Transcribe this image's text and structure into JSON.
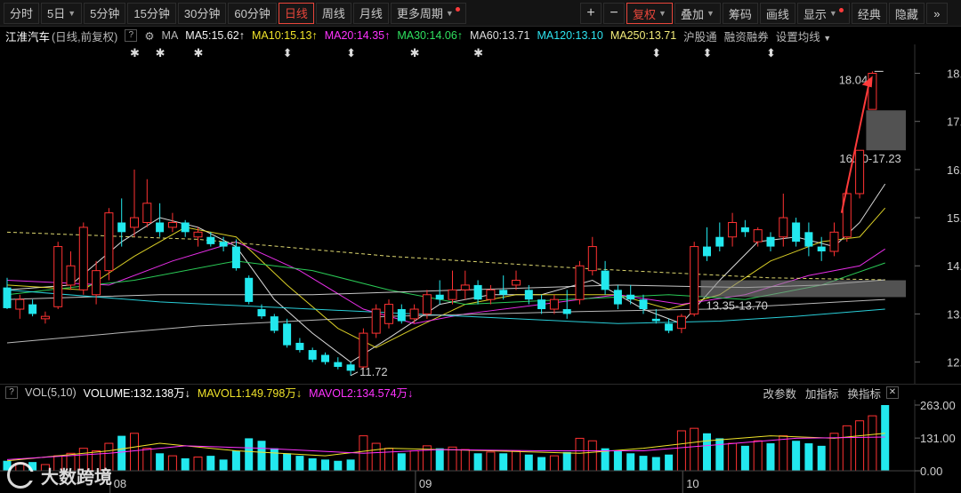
{
  "toolbar": {
    "periods": [
      {
        "label": "分时",
        "active": false,
        "caret": false
      },
      {
        "label": "5日",
        "active": false,
        "caret": true
      },
      {
        "label": "5分钟",
        "active": false,
        "caret": false
      },
      {
        "label": "15分钟",
        "active": false,
        "caret": false
      },
      {
        "label": "30分钟",
        "active": false,
        "caret": false
      },
      {
        "label": "60分钟",
        "active": false,
        "caret": false
      },
      {
        "label": "日线",
        "active": true,
        "caret": false
      },
      {
        "label": "周线",
        "active": false,
        "caret": false
      },
      {
        "label": "月线",
        "active": false,
        "caret": false
      },
      {
        "label": "更多周期",
        "active": false,
        "caret": true,
        "dot": true
      }
    ],
    "zoom_in": "+",
    "zoom_out": "−",
    "fuquan": "复权",
    "right_buttons": [
      {
        "label": "叠加",
        "caret": true
      },
      {
        "label": "筹码",
        "caret": false
      },
      {
        "label": "画线",
        "caret": false
      },
      {
        "label": "显示",
        "caret": true,
        "dot": true
      },
      {
        "label": "经典",
        "caret": false
      },
      {
        "label": "隐藏",
        "caret": false
      }
    ],
    "more_arrow": "»"
  },
  "ma_line": {
    "stock_name": "江淮汽车",
    "mode": "(日线,前复权)",
    "help": "?",
    "ma_label": "MA",
    "ma5": "MA5:15.62",
    "ma10": "MA10:15.13",
    "ma20": "MA20:14.35",
    "ma30": "MA30:14.06",
    "ma60": "MA60:13.71",
    "ma120": "MA120:13.10",
    "ma250": "MA250:13.71",
    "hgt": "沪股通",
    "rzrq": "融资融券",
    "set_ma": "设置均线",
    "up_arrow": "↑",
    "colors": {
      "ma5": "#f2f2f2",
      "ma10": "#f0e32a",
      "ma20": "#ff33ff",
      "ma30": "#2fe05f",
      "ma60": "#dddddd",
      "ma120": "#2ee4f0",
      "ma250": "#f3ec7a"
    }
  },
  "chart_data": {
    "type": "candlestick",
    "price_ticks": [
      "18.00",
      "17.00",
      "16.00",
      "15.00",
      "14.00",
      "13.00",
      "12.00"
    ],
    "ylim": [
      11.55,
      18.6
    ],
    "month_labels": [
      {
        "label": "08",
        "index": 9
      },
      {
        "label": "09",
        "index": 33
      },
      {
        "label": "10",
        "index": 54
      }
    ],
    "candles": [
      {
        "o": 13.55,
        "h": 13.75,
        "l": 13.1,
        "c": 13.12
      },
      {
        "o": 13.1,
        "h": 13.4,
        "l": 12.9,
        "c": 13.3
      },
      {
        "o": 13.2,
        "h": 13.3,
        "l": 12.95,
        "c": 13.0
      },
      {
        "o": 12.9,
        "h": 13.05,
        "l": 12.8,
        "c": 12.95
      },
      {
        "o": 13.15,
        "h": 14.5,
        "l": 13.1,
        "c": 14.4
      },
      {
        "o": 13.6,
        "h": 14.3,
        "l": 13.5,
        "c": 14.0
      },
      {
        "o": 13.5,
        "h": 14.9,
        "l": 13.4,
        "c": 14.8
      },
      {
        "o": 13.4,
        "h": 14.1,
        "l": 13.2,
        "c": 13.9
      },
      {
        "o": 13.9,
        "h": 15.2,
        "l": 13.7,
        "c": 15.1
      },
      {
        "o": 14.9,
        "h": 15.4,
        "l": 14.4,
        "c": 14.7
      },
      {
        "o": 14.8,
        "h": 16.0,
        "l": 14.6,
        "c": 15.0
      },
      {
        "o": 14.9,
        "h": 15.8,
        "l": 14.8,
        "c": 15.3
      },
      {
        "o": 14.9,
        "h": 15.3,
        "l": 14.6,
        "c": 14.7
      },
      {
        "o": 14.8,
        "h": 15.1,
        "l": 14.7,
        "c": 14.9
      },
      {
        "o": 14.9,
        "h": 14.95,
        "l": 14.6,
        "c": 14.7
      },
      {
        "o": 14.6,
        "h": 14.8,
        "l": 14.4,
        "c": 14.7
      },
      {
        "o": 14.6,
        "h": 14.7,
        "l": 14.4,
        "c": 14.45
      },
      {
        "o": 14.5,
        "h": 14.6,
        "l": 14.3,
        "c": 14.4
      },
      {
        "o": 14.4,
        "h": 14.55,
        "l": 13.9,
        "c": 13.95
      },
      {
        "o": 13.75,
        "h": 13.8,
        "l": 13.2,
        "c": 13.25
      },
      {
        "o": 13.1,
        "h": 13.2,
        "l": 12.9,
        "c": 12.95
      },
      {
        "o": 12.95,
        "h": 13.0,
        "l": 12.6,
        "c": 12.65
      },
      {
        "o": 12.8,
        "h": 12.9,
        "l": 12.3,
        "c": 12.35
      },
      {
        "o": 12.4,
        "h": 12.5,
        "l": 12.2,
        "c": 12.25
      },
      {
        "o": 12.25,
        "h": 12.3,
        "l": 12.0,
        "c": 12.05
      },
      {
        "o": 12.15,
        "h": 12.2,
        "l": 11.95,
        "c": 12.0
      },
      {
        "o": 12.0,
        "h": 12.1,
        "l": 11.85,
        "c": 11.9
      },
      {
        "o": 11.95,
        "h": 12.0,
        "l": 11.72,
        "c": 11.82
      },
      {
        "o": 11.9,
        "h": 12.7,
        "l": 11.85,
        "c": 12.6
      },
      {
        "o": 12.6,
        "h": 13.2,
        "l": 12.5,
        "c": 13.1
      },
      {
        "o": 12.8,
        "h": 13.3,
        "l": 12.7,
        "c": 13.2
      },
      {
        "o": 13.1,
        "h": 13.2,
        "l": 12.8,
        "c": 12.85
      },
      {
        "o": 12.9,
        "h": 13.2,
        "l": 12.8,
        "c": 13.1
      },
      {
        "o": 13.0,
        "h": 13.5,
        "l": 12.9,
        "c": 13.4
      },
      {
        "o": 13.4,
        "h": 13.7,
        "l": 13.2,
        "c": 13.3
      },
      {
        "o": 13.3,
        "h": 13.9,
        "l": 13.2,
        "c": 13.5
      },
      {
        "o": 13.5,
        "h": 13.9,
        "l": 13.3,
        "c": 13.6
      },
      {
        "o": 13.6,
        "h": 13.7,
        "l": 13.2,
        "c": 13.3
      },
      {
        "o": 13.3,
        "h": 13.6,
        "l": 13.2,
        "c": 13.5
      },
      {
        "o": 13.5,
        "h": 13.8,
        "l": 13.3,
        "c": 13.4
      },
      {
        "o": 13.6,
        "h": 13.9,
        "l": 13.5,
        "c": 13.7
      },
      {
        "o": 13.5,
        "h": 13.6,
        "l": 13.2,
        "c": 13.3
      },
      {
        "o": 13.3,
        "h": 13.4,
        "l": 13.0,
        "c": 13.1
      },
      {
        "o": 13.1,
        "h": 13.4,
        "l": 13.0,
        "c": 13.3
      },
      {
        "o": 13.1,
        "h": 13.5,
        "l": 12.9,
        "c": 13.0
      },
      {
        "o": 13.3,
        "h": 14.1,
        "l": 13.2,
        "c": 14.0
      },
      {
        "o": 13.9,
        "h": 14.6,
        "l": 13.8,
        "c": 14.4
      },
      {
        "o": 13.9,
        "h": 14.1,
        "l": 13.4,
        "c": 13.5
      },
      {
        "o": 13.5,
        "h": 13.6,
        "l": 13.1,
        "c": 13.2
      },
      {
        "o": 13.4,
        "h": 13.6,
        "l": 13.2,
        "c": 13.3
      },
      {
        "o": 13.3,
        "h": 13.4,
        "l": 13.0,
        "c": 13.1
      },
      {
        "o": 12.9,
        "h": 13.1,
        "l": 12.8,
        "c": 12.85
      },
      {
        "o": 12.8,
        "h": 12.9,
        "l": 12.6,
        "c": 12.65
      },
      {
        "o": 12.7,
        "h": 13.0,
        "l": 12.6,
        "c": 12.95
      },
      {
        "o": 13.0,
        "h": 14.5,
        "l": 12.95,
        "c": 14.4
      },
      {
        "o": 14.4,
        "h": 14.8,
        "l": 14.1,
        "c": 14.2
      },
      {
        "o": 14.6,
        "h": 14.9,
        "l": 14.3,
        "c": 14.4
      },
      {
        "o": 14.6,
        "h": 15.1,
        "l": 14.4,
        "c": 14.9
      },
      {
        "o": 14.8,
        "h": 14.95,
        "l": 14.6,
        "c": 14.7
      },
      {
        "o": 14.5,
        "h": 14.8,
        "l": 14.4,
        "c": 14.75
      },
      {
        "o": 14.6,
        "h": 14.7,
        "l": 14.3,
        "c": 14.4
      },
      {
        "o": 14.6,
        "h": 15.5,
        "l": 14.4,
        "c": 15.0
      },
      {
        "o": 14.9,
        "h": 15.0,
        "l": 14.4,
        "c": 14.5
      },
      {
        "o": 14.7,
        "h": 14.9,
        "l": 14.2,
        "c": 14.4
      },
      {
        "o": 14.4,
        "h": 14.6,
        "l": 14.1,
        "c": 14.3
      },
      {
        "o": 14.3,
        "h": 14.9,
        "l": 14.2,
        "c": 14.7
      },
      {
        "o": 14.6,
        "h": 15.6,
        "l": 14.5,
        "c": 15.5
      },
      {
        "o": 15.5,
        "h": 16.4,
        "l": 15.4,
        "c": 16.4
      },
      {
        "o": 17.25,
        "h": 18.04,
        "l": 17.25,
        "c": 18.0
      }
    ],
    "ma_series": [
      {
        "key": "ma5",
        "color": "#f2f2f2",
        "values": [
          [
            0,
            13.5
          ],
          [
            5,
            13.6
          ],
          [
            9,
            14.5
          ],
          [
            12,
            15.0
          ],
          [
            15,
            14.8
          ],
          [
            18,
            14.4
          ],
          [
            21,
            13.3
          ],
          [
            24,
            12.6
          ],
          [
            27,
            12.0
          ],
          [
            30,
            12.5
          ],
          [
            34,
            13.2
          ],
          [
            38,
            13.4
          ],
          [
            42,
            13.4
          ],
          [
            46,
            13.7
          ],
          [
            50,
            13.1
          ],
          [
            53,
            12.8
          ],
          [
            56,
            13.7
          ],
          [
            59,
            14.5
          ],
          [
            62,
            14.6
          ],
          [
            65,
            14.4
          ],
          [
            67,
            14.9
          ],
          [
            69,
            15.7
          ]
        ]
      },
      {
        "key": "ma10",
        "color": "#f0e32a",
        "values": [
          [
            0,
            13.6
          ],
          [
            6,
            13.5
          ],
          [
            10,
            14.2
          ],
          [
            14,
            14.8
          ],
          [
            18,
            14.6
          ],
          [
            22,
            13.6
          ],
          [
            26,
            12.7
          ],
          [
            29,
            12.3
          ],
          [
            32,
            12.7
          ],
          [
            36,
            13.2
          ],
          [
            40,
            13.4
          ],
          [
            44,
            13.4
          ],
          [
            48,
            13.4
          ],
          [
            52,
            13.1
          ],
          [
            56,
            13.4
          ],
          [
            60,
            14.1
          ],
          [
            64,
            14.5
          ],
          [
            67,
            14.6
          ],
          [
            69,
            15.2
          ]
        ]
      },
      {
        "key": "ma20",
        "color": "#ff33ff",
        "values": [
          [
            0,
            13.7
          ],
          [
            8,
            13.6
          ],
          [
            13,
            14.1
          ],
          [
            18,
            14.5
          ],
          [
            23,
            13.9
          ],
          [
            28,
            13.1
          ],
          [
            32,
            12.8
          ],
          [
            36,
            13.0
          ],
          [
            42,
            13.2
          ],
          [
            48,
            13.4
          ],
          [
            53,
            13.2
          ],
          [
            58,
            13.4
          ],
          [
            63,
            13.8
          ],
          [
            67,
            14.0
          ],
          [
            69,
            14.35
          ]
        ]
      },
      {
        "key": "ma30",
        "color": "#2fe05f",
        "values": [
          [
            0,
            13.4
          ],
          [
            10,
            13.7
          ],
          [
            18,
            14.1
          ],
          [
            24,
            13.9
          ],
          [
            30,
            13.5
          ],
          [
            36,
            13.2
          ],
          [
            44,
            13.3
          ],
          [
            52,
            13.4
          ],
          [
            58,
            13.3
          ],
          [
            64,
            13.6
          ],
          [
            69,
            14.06
          ]
        ]
      },
      {
        "key": "ma60",
        "color": "#dddddd",
        "values": [
          [
            0,
            13.3
          ],
          [
            12,
            13.4
          ],
          [
            24,
            13.4
          ],
          [
            36,
            13.5
          ],
          [
            48,
            13.6
          ],
          [
            58,
            13.55
          ],
          [
            64,
            13.6
          ],
          [
            69,
            13.71
          ]
        ]
      },
      {
        "key": "ma120",
        "color": "#2ee4f0",
        "values": [
          [
            0,
            13.5
          ],
          [
            12,
            13.25
          ],
          [
            24,
            13.1
          ],
          [
            36,
            12.95
          ],
          [
            48,
            12.8
          ],
          [
            56,
            12.85
          ],
          [
            62,
            12.95
          ],
          [
            69,
            13.1
          ]
        ]
      },
      {
        "key": "ma250",
        "color": "#f3ec7a",
        "dashed": true,
        "values": [
          [
            0,
            14.7
          ],
          [
            15,
            14.55
          ],
          [
            30,
            14.2
          ],
          [
            45,
            13.95
          ],
          [
            60,
            13.75
          ],
          [
            69,
            13.71
          ]
        ]
      },
      {
        "key": "long",
        "color": "#cccccc",
        "values": [
          [
            0,
            12.4
          ],
          [
            15,
            12.75
          ],
          [
            30,
            12.95
          ],
          [
            45,
            13.05
          ],
          [
            55,
            13.1
          ],
          [
            69,
            13.3
          ]
        ]
      }
    ],
    "gap_boxes": [
      {
        "from": 16.4,
        "to": 17.23,
        "label": "16.40-17.23"
      },
      {
        "from": 13.35,
        "to": 13.7,
        "label": "13.35-13.70"
      }
    ],
    "annotations": [
      {
        "label": "18.04",
        "price": 18.04,
        "index": 69
      },
      {
        "label": "11.72",
        "price": 11.72,
        "index": 27
      }
    ],
    "event_markers": [
      {
        "index": 10,
        "glyph": "✱"
      },
      {
        "index": 12,
        "glyph": "✱"
      },
      {
        "index": 15,
        "glyph": "✱"
      },
      {
        "index": 22,
        "glyph": "⬍"
      },
      {
        "index": 27,
        "glyph": "⬍"
      },
      {
        "index": 32,
        "glyph": "✱"
      },
      {
        "index": 37,
        "glyph": "✱"
      },
      {
        "index": 51,
        "glyph": "⬍"
      },
      {
        "index": 55,
        "glyph": "⬍"
      },
      {
        "index": 60,
        "glyph": "⬍"
      }
    ],
    "volume": {
      "ticks": [
        "263.00",
        "131.00",
        "0.00"
      ],
      "ylim": [
        0,
        263
      ],
      "values": [
        40,
        30,
        35,
        25,
        60,
        70,
        90,
        80,
        110,
        140,
        150,
        90,
        70,
        60,
        50,
        55,
        60,
        45,
        80,
        130,
        120,
        90,
        70,
        60,
        50,
        45,
        40,
        45,
        140,
        110,
        90,
        70,
        80,
        100,
        90,
        95,
        85,
        70,
        75,
        70,
        80,
        65,
        55,
        60,
        75,
        130,
        120,
        90,
        80,
        70,
        60,
        55,
        65,
        160,
        170,
        150,
        130,
        110,
        100,
        120,
        110,
        140,
        120,
        110,
        100,
        150,
        180,
        200,
        220,
        263
      ],
      "mavol1": [
        [
          0,
          40
        ],
        [
          8,
          80
        ],
        [
          12,
          110
        ],
        [
          18,
          80
        ],
        [
          25,
          60
        ],
        [
          30,
          90
        ],
        [
          38,
          80
        ],
        [
          45,
          70
        ],
        [
          50,
          90
        ],
        [
          55,
          120
        ],
        [
          60,
          140
        ],
        [
          65,
          130
        ],
        [
          69,
          150
        ]
      ],
      "mavol2": [
        [
          0,
          45
        ],
        [
          8,
          70
        ],
        [
          14,
          100
        ],
        [
          20,
          90
        ],
        [
          28,
          70
        ],
        [
          34,
          85
        ],
        [
          42,
          80
        ],
        [
          50,
          80
        ],
        [
          56,
          105
        ],
        [
          62,
          130
        ],
        [
          69,
          135
        ]
      ],
      "mavol1_color": "#f0e32a",
      "mavol2_color": "#ff33ff"
    }
  },
  "vol_line": {
    "title": "VOL(5,10)",
    "volume": "VOLUME:132.138万",
    "down_arrow": "↓",
    "mavol1": "MAVOL1:149.798万",
    "mavol2": "MAVOL2:134.574万",
    "actions": [
      "改参数",
      "加指标",
      "换指标"
    ]
  },
  "watermark": "大数跨境",
  "colors": {
    "up": "#ff3232",
    "down": "#22e8ee",
    "accent": "#e8463b",
    "axis": "#cfcfcf",
    "gap_box": "#888888",
    "arrow": "#ff3b3b"
  }
}
